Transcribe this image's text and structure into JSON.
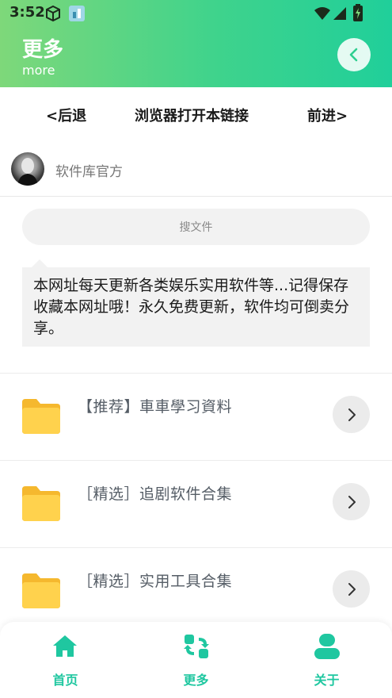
{
  "status_bar": {
    "time": "3:52",
    "icons": [
      "box-icon",
      "app-icon",
      "wifi-icon",
      "signal-icon",
      "battery-icon"
    ]
  },
  "header": {
    "title": "更多",
    "subtitle": "more",
    "back_icon": "chevron-left-icon"
  },
  "browser_nav": {
    "back": "<后退",
    "open_in_browser": "浏览器打开本链接",
    "forward": "前进>"
  },
  "profile": {
    "name": "软件库官方"
  },
  "search": {
    "placeholder": "搜文件"
  },
  "notice": {
    "text": "本网址每天更新各类娱乐实用软件等...记得保存收藏本网址哦！永久免费更新，软件均可倒卖分享。"
  },
  "folders": [
    {
      "label": "【推荐】車車學习資料",
      "icon": "folder-icon"
    },
    {
      "label": "［精选］追剧软件合集",
      "icon": "folder-icon"
    },
    {
      "label": "［精选］实用工具合集",
      "icon": "folder-icon"
    }
  ],
  "bottom_nav": {
    "tabs": [
      {
        "label": "首页",
        "icon": "home-icon"
      },
      {
        "label": "更多",
        "icon": "swap-icon"
      },
      {
        "label": "关于",
        "icon": "user-icon"
      }
    ]
  },
  "colors": {
    "accent": "#1fc7a0",
    "header_gradient_start": "#7ed87a",
    "header_gradient_end": "#20cf9a",
    "folder": "#ffd24d"
  }
}
